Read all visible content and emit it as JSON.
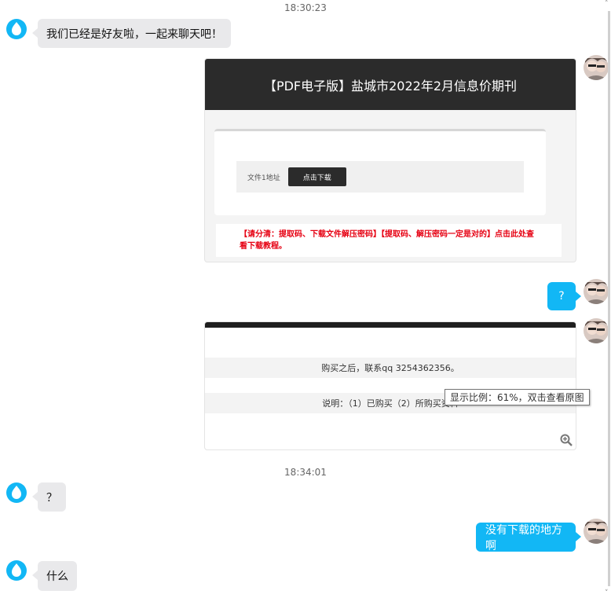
{
  "timestamps": [
    "18:30:23",
    "18:34:01"
  ],
  "messages": {
    "m1": "我们已经是好友啦，一起来聊天吧！",
    "m2": "？",
    "m3": "?",
    "m4": "没有下载的地方啊",
    "m5": "什么"
  },
  "card1": {
    "title": "【PDF电子版】盐城市2022年2月信息价期刊",
    "file_label": "文件1地址",
    "download_button": "点击下载",
    "notice": "【请分清：提取码、下载文件解压密码】【提取码、解压密码一定是对的】点击此处查看下载教程。"
  },
  "card2": {
    "contact": "购买之后，联系qq 3254362356。",
    "description": "说明：（1）已购买（2）所购买资料"
  },
  "tooltip": "显示比例：61%，双击查看原图",
  "icons": {
    "left_avatar": "qq-logo-icon",
    "right_avatar": "user-photo-avatar",
    "zoom": "zoom-in-icon"
  },
  "colors": {
    "sent_bubble": "#12b7f5",
    "received_bubble": "#e9e9eb",
    "notice_red": "#e60012",
    "card_header": "#2b2b2b"
  }
}
